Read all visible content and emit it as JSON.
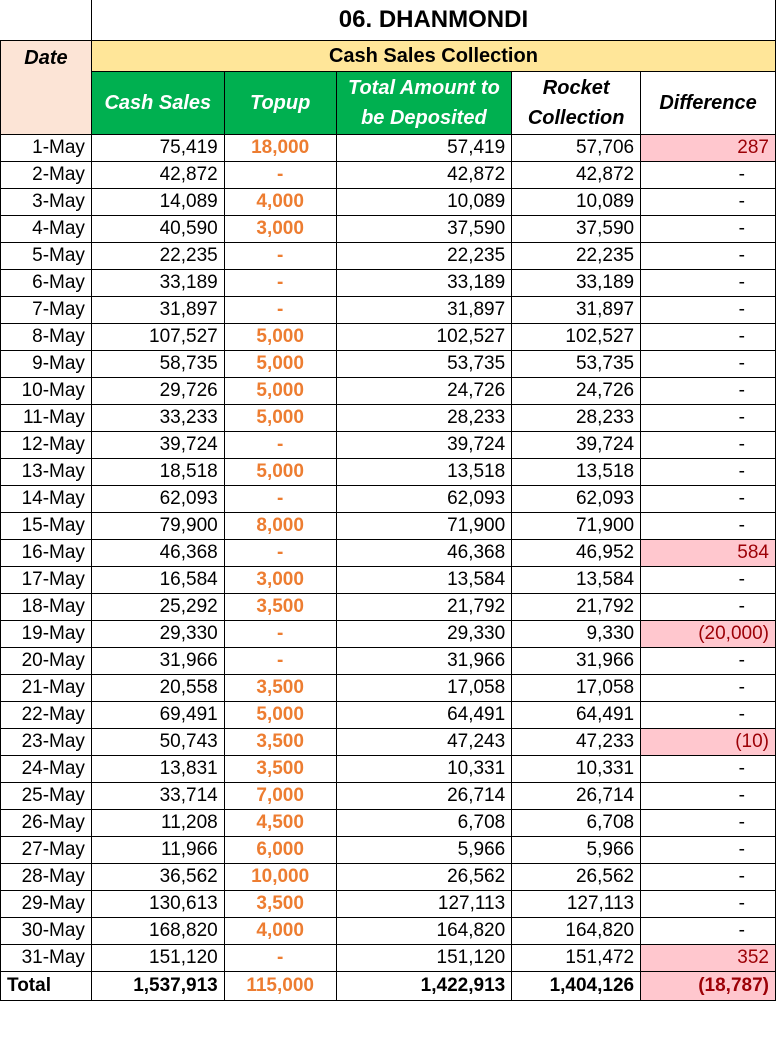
{
  "title": "06. DHANMONDI",
  "section": "Cash Sales Collection",
  "headers": {
    "date": "Date",
    "cash_sales": "Cash Sales",
    "topup": "Topup",
    "total_amount": "Total Amount to be Deposited",
    "rocket": "Rocket Collection",
    "difference": "Difference"
  },
  "rows": [
    {
      "date": "1-May",
      "cash": "75,419",
      "topup": "18,000",
      "total": "57,419",
      "rocket": "57,706",
      "diff": "287",
      "flag": true
    },
    {
      "date": "2-May",
      "cash": "42,872",
      "topup": "-",
      "total": "42,872",
      "rocket": "42,872",
      "diff": "-",
      "flag": false
    },
    {
      "date": "3-May",
      "cash": "14,089",
      "topup": "4,000",
      "total": "10,089",
      "rocket": "10,089",
      "diff": "-",
      "flag": false
    },
    {
      "date": "4-May",
      "cash": "40,590",
      "topup": "3,000",
      "total": "37,590",
      "rocket": "37,590",
      "diff": "-",
      "flag": false
    },
    {
      "date": "5-May",
      "cash": "22,235",
      "topup": "-",
      "total": "22,235",
      "rocket": "22,235",
      "diff": "-",
      "flag": false
    },
    {
      "date": "6-May",
      "cash": "33,189",
      "topup": "-",
      "total": "33,189",
      "rocket": "33,189",
      "diff": "-",
      "flag": false
    },
    {
      "date": "7-May",
      "cash": "31,897",
      "topup": "-",
      "total": "31,897",
      "rocket": "31,897",
      "diff": "-",
      "flag": false
    },
    {
      "date": "8-May",
      "cash": "107,527",
      "topup": "5,000",
      "total": "102,527",
      "rocket": "102,527",
      "diff": "-",
      "flag": false
    },
    {
      "date": "9-May",
      "cash": "58,735",
      "topup": "5,000",
      "total": "53,735",
      "rocket": "53,735",
      "diff": "-",
      "flag": false
    },
    {
      "date": "10-May",
      "cash": "29,726",
      "topup": "5,000",
      "total": "24,726",
      "rocket": "24,726",
      "diff": "-",
      "flag": false
    },
    {
      "date": "11-May",
      "cash": "33,233",
      "topup": "5,000",
      "total": "28,233",
      "rocket": "28,233",
      "diff": "-",
      "flag": false
    },
    {
      "date": "12-May",
      "cash": "39,724",
      "topup": "-",
      "total": "39,724",
      "rocket": "39,724",
      "diff": "-",
      "flag": false
    },
    {
      "date": "13-May",
      "cash": "18,518",
      "topup": "5,000",
      "total": "13,518",
      "rocket": "13,518",
      "diff": "-",
      "flag": false
    },
    {
      "date": "14-May",
      "cash": "62,093",
      "topup": "-",
      "total": "62,093",
      "rocket": "62,093",
      "diff": "-",
      "flag": false
    },
    {
      "date": "15-May",
      "cash": "79,900",
      "topup": "8,000",
      "total": "71,900",
      "rocket": "71,900",
      "diff": "-",
      "flag": false
    },
    {
      "date": "16-May",
      "cash": "46,368",
      "topup": "-",
      "total": "46,368",
      "rocket": "46,952",
      "diff": "584",
      "flag": true
    },
    {
      "date": "17-May",
      "cash": "16,584",
      "topup": "3,000",
      "total": "13,584",
      "rocket": "13,584",
      "diff": "-",
      "flag": false
    },
    {
      "date": "18-May",
      "cash": "25,292",
      "topup": "3,500",
      "total": "21,792",
      "rocket": "21,792",
      "diff": "-",
      "flag": false
    },
    {
      "date": "19-May",
      "cash": "29,330",
      "topup": "-",
      "total": "29,330",
      "rocket": "9,330",
      "diff": "(20,000)",
      "flag": true
    },
    {
      "date": "20-May",
      "cash": "31,966",
      "topup": "-",
      "total": "31,966",
      "rocket": "31,966",
      "diff": "-",
      "flag": false
    },
    {
      "date": "21-May",
      "cash": "20,558",
      "topup": "3,500",
      "total": "17,058",
      "rocket": "17,058",
      "diff": "-",
      "flag": false
    },
    {
      "date": "22-May",
      "cash": "69,491",
      "topup": "5,000",
      "total": "64,491",
      "rocket": "64,491",
      "diff": "-",
      "flag": false
    },
    {
      "date": "23-May",
      "cash": "50,743",
      "topup": "3,500",
      "total": "47,243",
      "rocket": "47,233",
      "diff": "(10)",
      "flag": true
    },
    {
      "date": "24-May",
      "cash": "13,831",
      "topup": "3,500",
      "total": "10,331",
      "rocket": "10,331",
      "diff": "-",
      "flag": false
    },
    {
      "date": "25-May",
      "cash": "33,714",
      "topup": "7,000",
      "total": "26,714",
      "rocket": "26,714",
      "diff": "-",
      "flag": false
    },
    {
      "date": "26-May",
      "cash": "11,208",
      "topup": "4,500",
      "total": "6,708",
      "rocket": "6,708",
      "diff": "-",
      "flag": false
    },
    {
      "date": "27-May",
      "cash": "11,966",
      "topup": "6,000",
      "total": "5,966",
      "rocket": "5,966",
      "diff": "-",
      "flag": false
    },
    {
      "date": "28-May",
      "cash": "36,562",
      "topup": "10,000",
      "total": "26,562",
      "rocket": "26,562",
      "diff": "-",
      "flag": false
    },
    {
      "date": "29-May",
      "cash": "130,613",
      "topup": "3,500",
      "total": "127,113",
      "rocket": "127,113",
      "diff": "-",
      "flag": false
    },
    {
      "date": "30-May",
      "cash": "168,820",
      "topup": "4,000",
      "total": "164,820",
      "rocket": "164,820",
      "diff": "-",
      "flag": false
    },
    {
      "date": "31-May",
      "cash": "151,120",
      "topup": "-",
      "total": "151,120",
      "rocket": "151,472",
      "diff": "352",
      "flag": true
    }
  ],
  "total": {
    "label": "Total",
    "cash": "1,537,913",
    "topup": "115,000",
    "total": "1,422,913",
    "rocket": "1,404,126",
    "diff": "(18,787)"
  },
  "colors": {
    "section_bg": "#ffe699",
    "date_header_bg": "#fce4d6",
    "green_header_bg": "#00b050",
    "topup_text": "#ed7d31",
    "flag_bg": "#ffc7ce",
    "flag_text": "#9c0006"
  }
}
